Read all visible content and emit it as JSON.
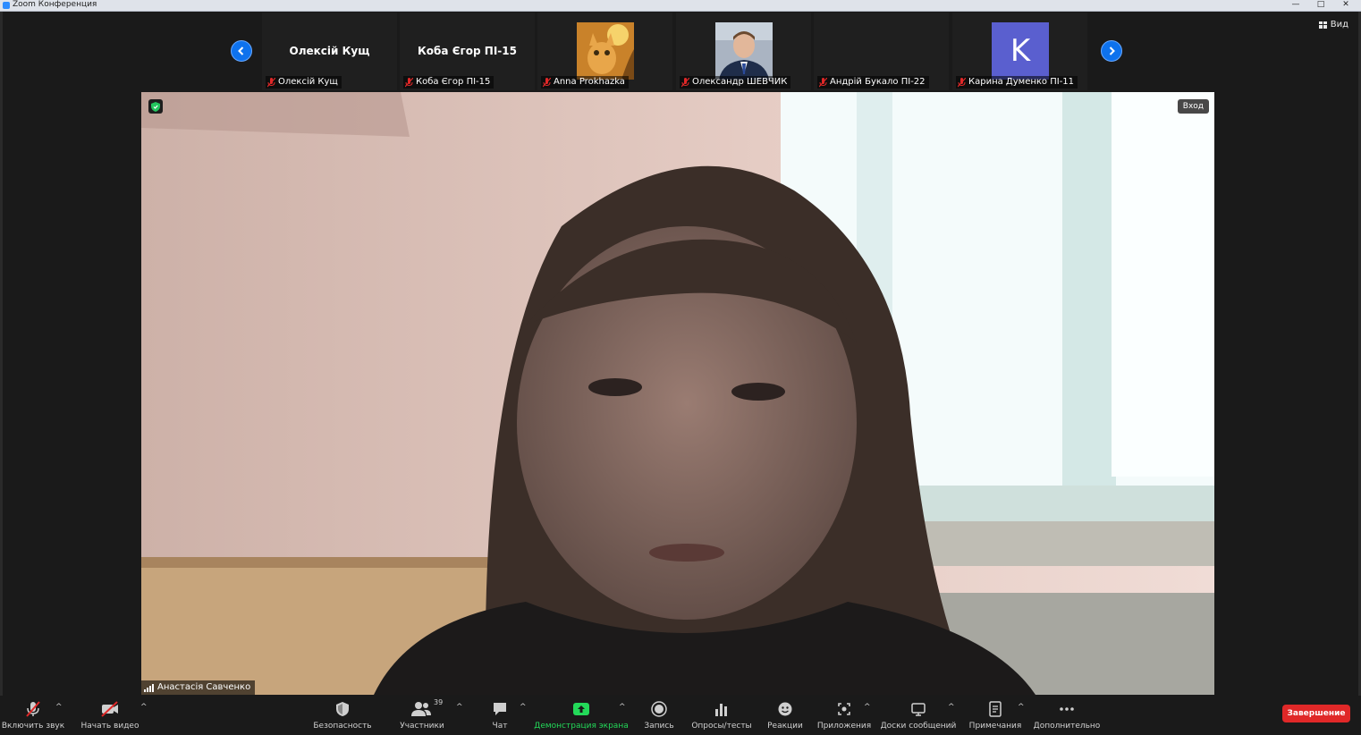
{
  "window": {
    "title": "Zoom Конференция",
    "controls": [
      "—",
      "□",
      "✕"
    ]
  },
  "view_button": {
    "label": "Вид"
  },
  "thumbnails": [
    {
      "big_name": "Олексій Кущ",
      "label": "Олексій Кущ",
      "kind": "name"
    },
    {
      "big_name": "Коба Єгор ПІ-15",
      "label": "Коба Єгор ПІ-15",
      "kind": "name"
    },
    {
      "big_name": "",
      "label": "Anna Prokhazka",
      "kind": "photo-cat"
    },
    {
      "big_name": "",
      "label": "Олександр ШЕВЧИК",
      "kind": "photo-man"
    },
    {
      "big_name": "",
      "label": "Андрій Букало ПІ-22",
      "kind": "empty"
    },
    {
      "big_name": "",
      "label": "Карина Думенко ПІ-11",
      "kind": "initial",
      "initial": "K",
      "color": "#5a5fcf"
    }
  ],
  "main_video": {
    "speaker": "Анастасія Савченко",
    "enter_button": "Вход"
  },
  "toolbar": {
    "unmute": "Включить звук",
    "start_video": "Начать видео",
    "security": "Безопасность",
    "participants": "Участники",
    "participants_count": "39",
    "chat": "Чат",
    "share_screen": "Демонстрация экрана",
    "record": "Запись",
    "polls": "Опросы/тесты",
    "reactions": "Реакции",
    "apps": "Приложения",
    "whiteboards": "Доски сообщений",
    "notes": "Примечания",
    "more": "Дополнительно",
    "end": "Завершение",
    "caret": "^"
  },
  "colors": {
    "accent": "#0e72ed",
    "share_green": "#23d959",
    "end_red": "#e02828",
    "mic_off_red": "#e02828"
  }
}
